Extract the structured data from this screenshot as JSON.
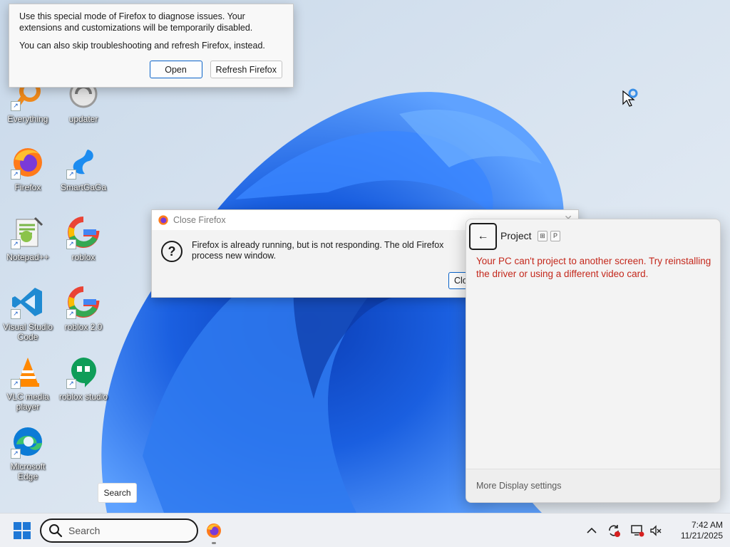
{
  "desktop": {
    "icons": [
      {
        "label": "Everything",
        "icon": "everything-icon"
      },
      {
        "label": "updater",
        "icon": "updater-icon"
      },
      {
        "label": "Firefox",
        "icon": "firefox-icon"
      },
      {
        "label": "SmartGaGa",
        "icon": "smartgaga-icon"
      },
      {
        "label": "Notepad++",
        "icon": "notepadpp-icon"
      },
      {
        "label": "roblox",
        "icon": "google-icon"
      },
      {
        "label": "Visual Studio Code",
        "icon": "vscode-icon"
      },
      {
        "label": "roblox 2.0",
        "icon": "google-icon"
      },
      {
        "label": "VLC media player",
        "icon": "vlc-icon"
      },
      {
        "label": "roblox studio",
        "icon": "hangouts-icon"
      },
      {
        "label": "Microsoft Edge",
        "icon": "edge-icon"
      }
    ]
  },
  "troubleshoot_dialog": {
    "line1": "Use this special mode of Firefox to diagnose issues. Your extensions and customizations will be temporarily disabled.",
    "line2": "You can also skip troubleshooting and refresh Firefox, instead.",
    "open_label": "Open",
    "refresh_label": "Refresh Firefox"
  },
  "close_firefox_dialog": {
    "title": "Close Firefox",
    "message": "Firefox is already running, but is not responding. The old Firefox process new window.",
    "close_label": "Clo"
  },
  "project_panel": {
    "title": "Project",
    "keys": [
      "⊞",
      "P"
    ],
    "error": "Your PC can't project to another screen. Try reinstalling the driver or using a different video card.",
    "footer_link": "More Display settings"
  },
  "search_tooltip": "Search",
  "taskbar": {
    "search_placeholder": "Search",
    "time": "7:42 AM",
    "date": "11/21/2025"
  },
  "colors": {
    "accent": "#0a63c9",
    "error": "#c4281c",
    "wallpaper_blue": "#1a5fd6"
  }
}
